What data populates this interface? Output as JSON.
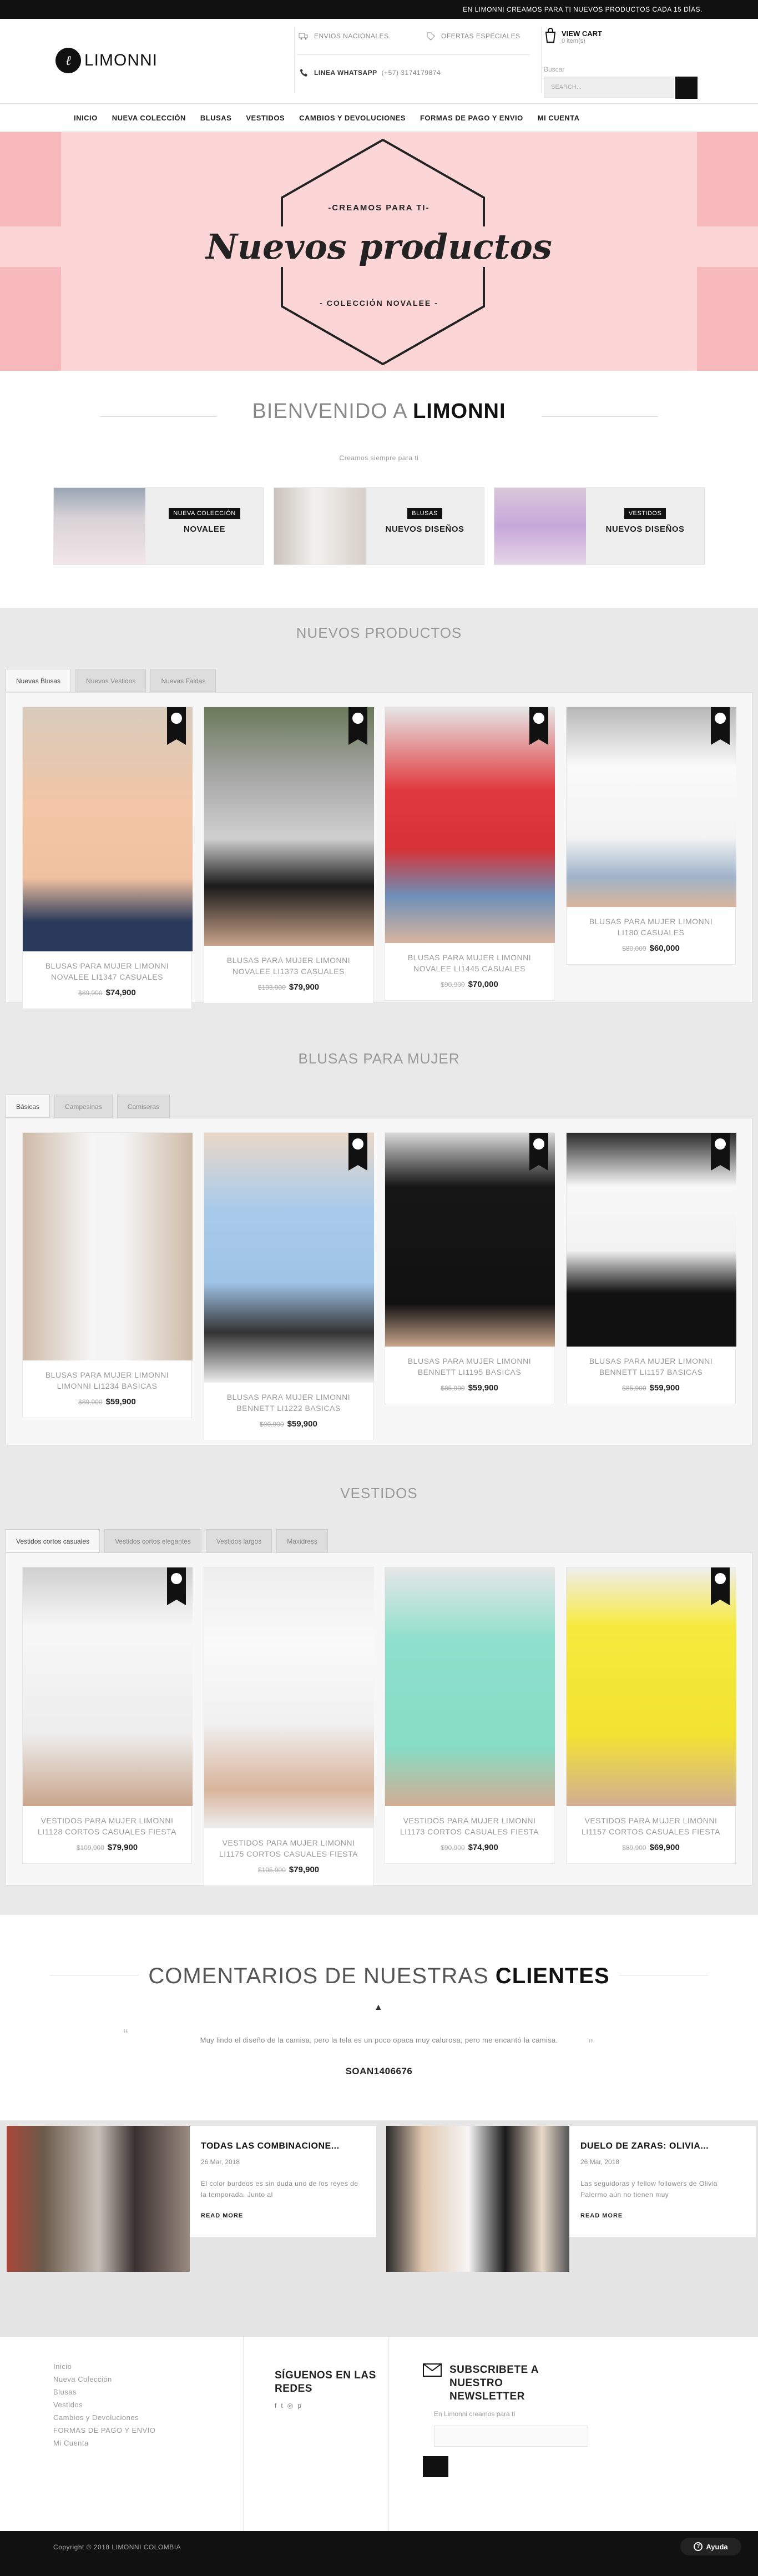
{
  "topbar": {
    "text": "EN LIMONNI CREAMOS PARA TI NUEVOS PRODUCTOS CADA 15 DÍAS."
  },
  "header": {
    "logo_text": "LIMONNI",
    "logo_mark": "ℓ",
    "envios": "ENVIOS NACIONALES",
    "ofertas": "OFERTAS ESPECIALES",
    "whatsapp_label": "LINEA WHATSAPP",
    "whatsapp_number": "(+57) 3174179874",
    "cart_title": "VIEW CART",
    "cart_sub": "0 item(s)",
    "search_label": "Buscar",
    "search_placeholder": "SEARCH..."
  },
  "nav": [
    "INICIO",
    "NUEVA COLECCIÓN",
    "BLUSAS",
    "VESTIDOS",
    "CAMBIOS Y DEVOLUCIONES",
    "FORMAS DE PAGO Y ENVIO",
    "MI CUENTA"
  ],
  "hero": {
    "kicker": "-CREAMOS PARA TI-",
    "title": "Nuevos productos",
    "sub": "- COLECCIÓN NOVALEE -"
  },
  "welcome": {
    "prefix": "BIENVENIDO A ",
    "brand": "LIMONNI",
    "sub": "Creamos siempre para ti"
  },
  "categories": [
    {
      "tag": "NUEVA COLECCIÓN",
      "name": "NOVALEE"
    },
    {
      "tag": "BLUSAS",
      "name": "NUEVOS DISEÑOS"
    },
    {
      "tag": "VESTIDOS",
      "name": "NUEVOS DISEÑOS"
    }
  ],
  "sections": [
    {
      "title": "NUEVOS PRODUCTOS",
      "tabs": [
        "Nuevas Blusas",
        "Nuevos Vestidos",
        "Nuevas Faldas"
      ],
      "products": [
        {
          "name": "BLUSAS PARA MUJER LIMONNI NOVALEE LI1347 CASUALES",
          "old": "$89,900",
          "price": "$74,900"
        },
        {
          "name": "BLUSAS PARA MUJER LIMONNI NOVALEE LI1373 CASUALES",
          "old": "$103,900",
          "price": "$79,900"
        },
        {
          "name": "BLUSAS PARA MUJER LIMONNI NOVALEE LI1445 CASUALES",
          "old": "$90,900",
          "price": "$70,000"
        },
        {
          "name": "BLUSAS PARA MUJER LIMONNI LI180 CASUALES",
          "old": "$80,000",
          "price": "$60,000"
        }
      ]
    },
    {
      "title": "BLUSAS PARA MUJER",
      "tabs": [
        "Básicas",
        "Campesinas",
        "Camiseras"
      ],
      "products": [
        {
          "name": "BLUSAS PARA MUJER LIMONNI LIMONNI LI1234 BASICAS",
          "old": "$89,900",
          "price": "$59,900"
        },
        {
          "name": "BLUSAS PARA MUJER LIMONNI BENNETT LI1222 BASICAS",
          "old": "$90,900",
          "price": "$59,900"
        },
        {
          "name": "BLUSAS PARA MUJER LIMONNI BENNETT LI1195 BASICAS",
          "old": "$85,900",
          "price": "$59,900"
        },
        {
          "name": "BLUSAS PARA MUJER LIMONNI BENNETT LI1157 BASICAS",
          "old": "$85,900",
          "price": "$59,900"
        }
      ]
    },
    {
      "title": "VESTIDOS",
      "tabs": [
        "Vestidos cortos casuales",
        "Vestidos cortos elegantes",
        "Vestidos largos",
        "Maxidress"
      ],
      "products": [
        {
          "name": "VESTIDOS PARA MUJER LIMONNI LI1128 CORTOS CASUALES FIESTA",
          "old": "$109,900",
          "price": "$79,900"
        },
        {
          "name": "VESTIDOS PARA MUJER LIMONNI LI1175 CORTOS CASUALES FIESTA",
          "old": "$105,900",
          "price": "$79,900"
        },
        {
          "name": "VESTIDOS PARA MUJER LIMONNI LI1173 CORTOS CASUALES FIESTA",
          "old": "$90,900",
          "price": "$74,900"
        },
        {
          "name": "VESTIDOS PARA MUJER LIMONNI LI1157 CORTOS CASUALES FIESTA",
          "old": "$89,900",
          "price": "$69,900"
        }
      ]
    }
  ],
  "testimonials": {
    "prefix": "COMENTARIOS DE NUESTRAS ",
    "bold": "CLIENTES",
    "quote": "Muy lindo el diseño de la camisa, pero la tela es un poco opaca muy calurosa, pero me encantó la camisa.",
    "author": "SOAN1406676"
  },
  "blog": [
    {
      "title": "TODAS LAS COMBINACIONE...",
      "date": "26 Mar, 2018",
      "excerpt": "El color burdeos es sin duda uno de los reyes de la temporada. Junto al",
      "more": "READ MORE"
    },
    {
      "title": "DUELO DE ZARAS: OLIVIA...",
      "date": "26 Mar, 2018",
      "excerpt": "Las seguidoras y fellow followers de Olivia Palermo aún no tienen muy",
      "more": "READ MORE"
    }
  ],
  "footer": {
    "links": [
      "Inicio",
      "Nueva Colección",
      "Blusas",
      "Vestidos",
      "Cambios y Devoluciones",
      "FORMAS DE PAGO Y ENVIO",
      "Mi Cuenta"
    ],
    "social_title": "SÍGUENOS EN LAS REDES",
    "newsletter_title": "SUBSCRIBETE A NUESTRO NEWSLETTER",
    "newsletter_sub": "En Limonni creamos para tí",
    "copyright": "Copyright © 2018 LIMONNI COLOMBIA",
    "help": "Ayuda"
  },
  "colors": {
    "hero_bg": "#fcd5d7",
    "dark": "#111111",
    "section_bg": "#e9e9e9"
  }
}
